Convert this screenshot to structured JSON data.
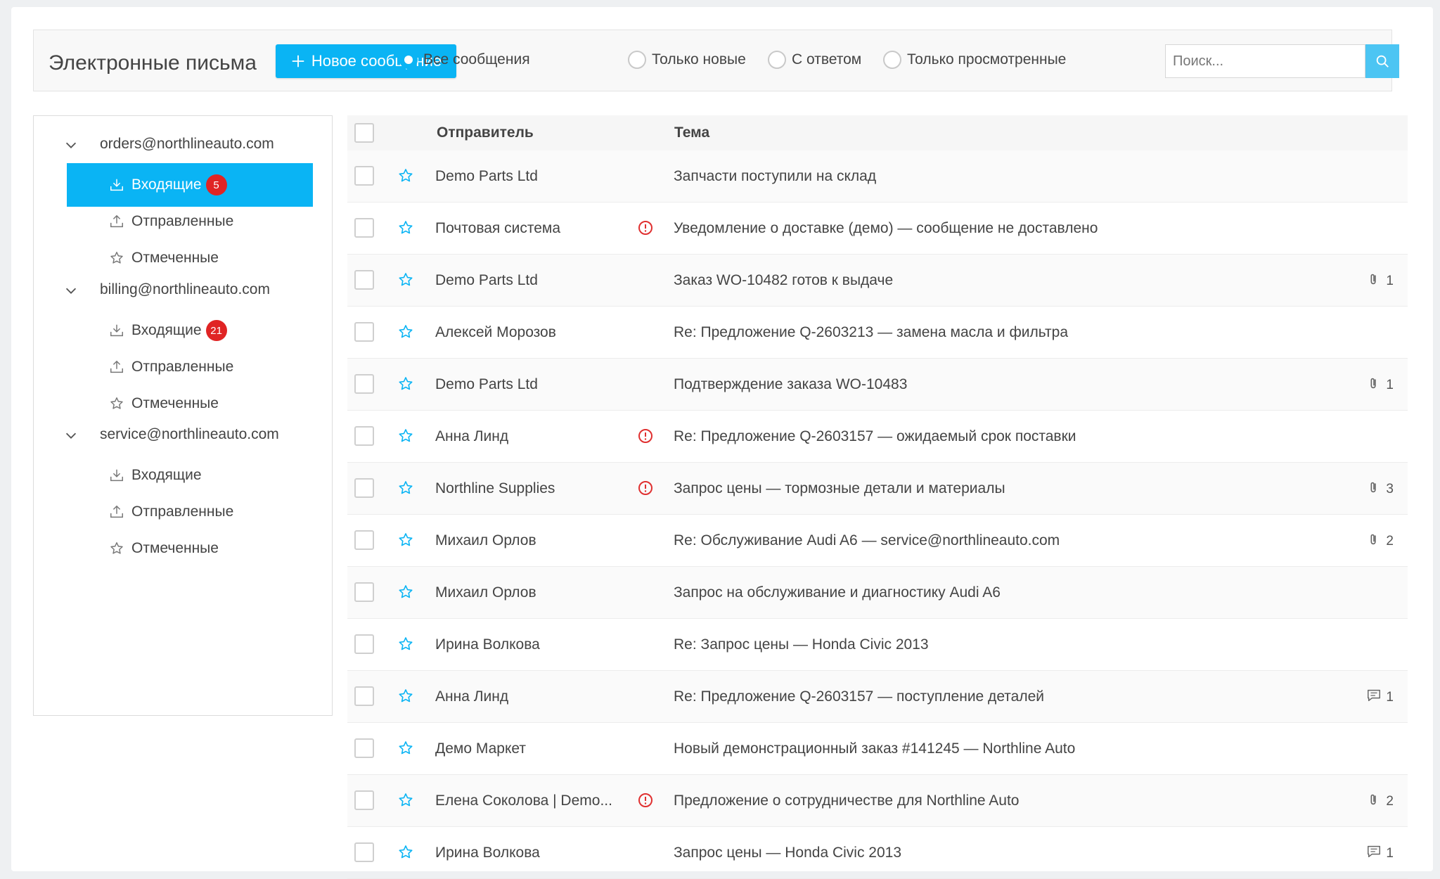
{
  "toolbar": {
    "title": "Электронные письма",
    "new_message_label": "Новое сообщение",
    "filters": [
      {
        "label": "Все сообщения",
        "selected": true
      },
      {
        "label": "Только новые",
        "selected": false
      },
      {
        "label": "С ответом",
        "selected": false
      },
      {
        "label": "Только просмотренные",
        "selected": false
      }
    ],
    "search_placeholder": "Поиск..."
  },
  "sidebar": {
    "accounts": [
      {
        "email": "orders@northlineauto.com",
        "folders": [
          {
            "label": "Входящие",
            "icon": "inbox-download-icon",
            "badge": "5",
            "active": true
          },
          {
            "label": "Отправленные",
            "icon": "upload-icon",
            "badge": "",
            "active": false
          },
          {
            "label": "Отмеченные",
            "icon": "star-outline-icon",
            "badge": "",
            "active": false
          }
        ]
      },
      {
        "email": "billing@northlineauto.com",
        "folders": [
          {
            "label": "Входящие",
            "icon": "inbox-download-icon",
            "badge": "21",
            "active": false
          },
          {
            "label": "Отправленные",
            "icon": "upload-icon",
            "badge": "",
            "active": false
          },
          {
            "label": "Отмеченные",
            "icon": "star-outline-icon",
            "badge": "",
            "active": false
          }
        ]
      },
      {
        "email": "service@northlineauto.com",
        "folders": [
          {
            "label": "Входящие",
            "icon": "inbox-download-icon",
            "badge": "",
            "active": false
          },
          {
            "label": "Отправленные",
            "icon": "upload-icon",
            "badge": "",
            "active": false
          },
          {
            "label": "Отмеченные",
            "icon": "star-outline-icon",
            "badge": "",
            "active": false
          }
        ]
      }
    ]
  },
  "list": {
    "columns": {
      "sender": "Отправитель",
      "subject": "Тема"
    },
    "rows": [
      {
        "sender": "Demo Parts Ltd",
        "subject": "Запчасти поступили на склад",
        "warning": false,
        "meta_icon": "",
        "meta_count": ""
      },
      {
        "sender": "Почтовая система",
        "subject": "Уведомление о доставке (демо) — сообщение не доставлено",
        "warning": true,
        "meta_icon": "",
        "meta_count": ""
      },
      {
        "sender": "Demo Parts Ltd",
        "subject": "Заказ WO-10482 готов к выдаче",
        "warning": false,
        "meta_icon": "paperclip-icon",
        "meta_count": "1"
      },
      {
        "sender": "Алексей Морозов",
        "subject": "Re: Предложение Q-2603213 — замена масла и фильтра",
        "warning": false,
        "meta_icon": "",
        "meta_count": ""
      },
      {
        "sender": "Demo Parts Ltd",
        "subject": "Подтверждение заказа WO-10483",
        "warning": false,
        "meta_icon": "paperclip-icon",
        "meta_count": "1"
      },
      {
        "sender": "Анна Линд",
        "subject": "Re: Предложение Q-2603157 — ожидаемый срок поставки",
        "warning": true,
        "meta_icon": "",
        "meta_count": ""
      },
      {
        "sender": "Northline Supplies",
        "subject": "Запрос цены — тормозные детали и материалы",
        "warning": true,
        "meta_icon": "paperclip-icon",
        "meta_count": "3"
      },
      {
        "sender": "Михаил Орлов",
        "subject": "Re: Обслуживание Audi A6 — service@northlineauto.com",
        "warning": false,
        "meta_icon": "paperclip-icon",
        "meta_count": "2"
      },
      {
        "sender": "Михаил Орлов",
        "subject": "Запрос на обслуживание и диагностику Audi A6",
        "warning": false,
        "meta_icon": "",
        "meta_count": ""
      },
      {
        "sender": "Ирина Волкова",
        "subject": "Re: Запрос цены — Honda Civic 2013",
        "warning": false,
        "meta_icon": "",
        "meta_count": ""
      },
      {
        "sender": "Анна Линд",
        "subject": "Re: Предложение Q-2603157 — поступление деталей",
        "warning": false,
        "meta_icon": "comment-icon",
        "meta_count": "1"
      },
      {
        "sender": "Демо Маркет",
        "subject": "Новый демонстрационный заказ #141245 — Northline Auto",
        "warning": false,
        "meta_icon": "",
        "meta_count": ""
      },
      {
        "sender": "Елена Соколова | Demo...",
        "subject": "Предложение о сотрудничестве для Northline Auto",
        "warning": true,
        "meta_icon": "paperclip-icon",
        "meta_count": "2"
      },
      {
        "sender": "Ирина Волкова",
        "subject": "Запрос цены — Honda Civic 2013",
        "warning": false,
        "meta_icon": "comment-icon",
        "meta_count": "1"
      }
    ]
  },
  "colors": {
    "accent": "#0ab4f4",
    "badge": "#e02424",
    "warning": "#e03030",
    "star": "#0ab4f4"
  }
}
